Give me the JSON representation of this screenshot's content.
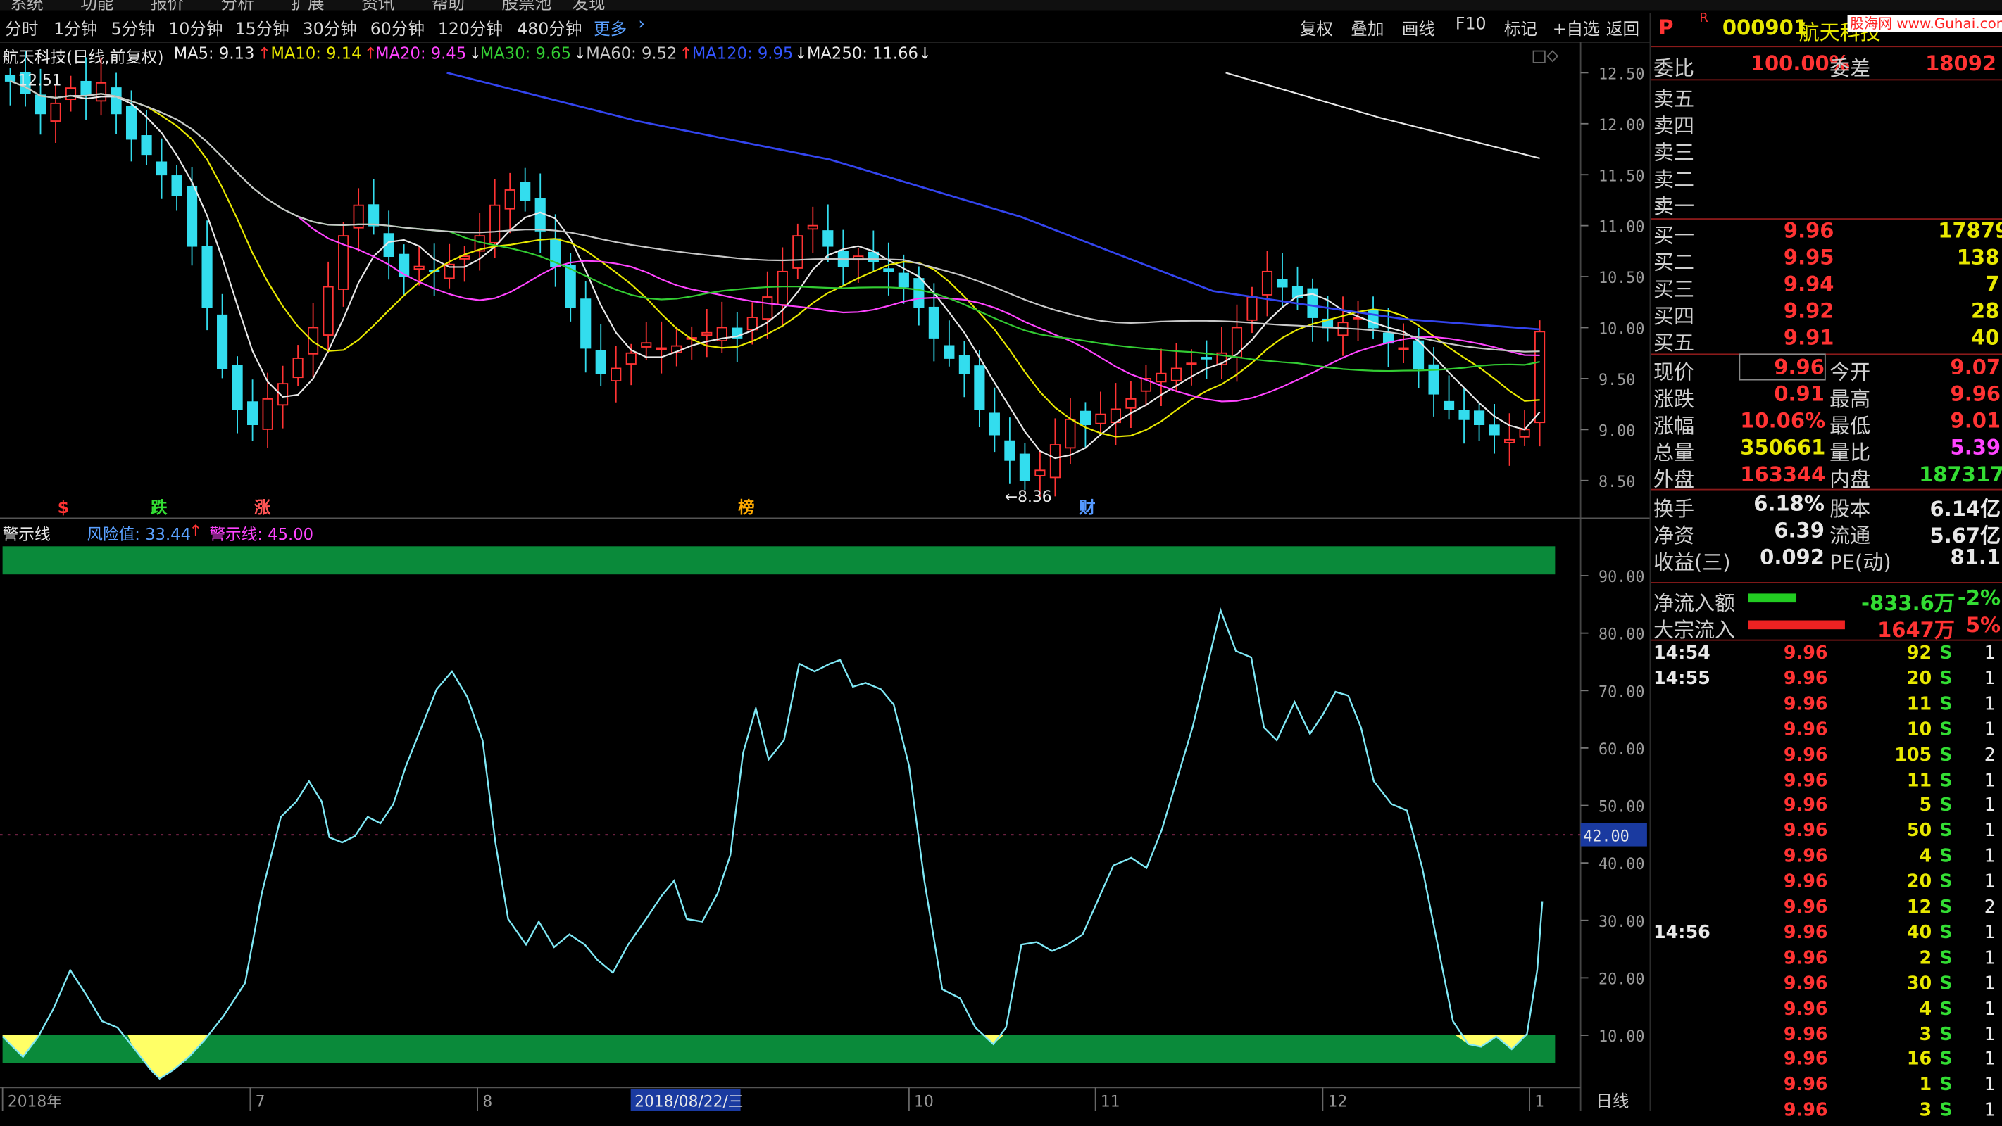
{
  "period_tabs": [
    "分时",
    "1分钟",
    "5分钟",
    "10分钟",
    "15分钟",
    "30分钟",
    "60分钟",
    "120分钟",
    "480分钟",
    "更多"
  ],
  "tools": [
    "复权",
    "叠加",
    "画线",
    "F10",
    "标记",
    "+自选",
    "返回"
  ],
  "chart_title": "航天科技(日线,前复权)",
  "ma": [
    {
      "label": "MA5: 9.13",
      "arrow": "↑",
      "color": "#e8e8e8"
    },
    {
      "label": "MA10: 9.14",
      "arrow": "↑",
      "color": "#e8e800"
    },
    {
      "label": "MA20: 9.45",
      "arrow": "↓",
      "color": "#ff44ff"
    },
    {
      "label": "MA30: 9.65",
      "arrow": "↓",
      "color": "#33cc33"
    },
    {
      "label": "MA60: 9.52",
      "arrow": "↑",
      "color": "#c8c8c8"
    },
    {
      "label": "MA120: 9.95",
      "arrow": "↓",
      "color": "#3355ff"
    },
    {
      "label": "MA250: 11.66",
      "arrow": "↓",
      "color": "#e8e8e8"
    }
  ],
  "price_axis": [
    "12.50",
    "12.00",
    "11.50",
    "11.00",
    "10.50",
    "10.00",
    "9.50",
    "9.00",
    "8.50"
  ],
  "high_label": "12.51",
  "low_label": "←8.36",
  "event_markers": [
    {
      "text": "$",
      "color": "#ff3333"
    },
    {
      "text": "跌",
      "color": "#33dd33"
    },
    {
      "text": "涨",
      "color": "#ff5555"
    },
    {
      "text": "榜",
      "color": "#ffaa00"
    },
    {
      "text": "财",
      "color": "#5599ff"
    }
  ],
  "indicator": {
    "name": "警示线",
    "risk_label": "风险值: 33.44",
    "risk_arrow": "↑",
    "warn_label": "警示线: 45.00",
    "axis": [
      "90.00",
      "80.00",
      "70.00",
      "60.00",
      "50.00",
      "40.00",
      "30.00",
      "20.00",
      "10.00"
    ],
    "ref_value": "42.00"
  },
  "date_axis": [
    "2018年",
    "7",
    "8",
    "2018/08/22/三",
    "10",
    "11",
    "12",
    "1"
  ],
  "period_label": "日线",
  "colors": {
    "up": "#ff3333",
    "down": "#33ddee",
    "ind_line": "#7fe8f5",
    "band": "#0a8a3a",
    "yellow": "#ffff66"
  },
  "quote": {
    "code": "000901",
    "name": "航天科技",
    "watermark": "股海网 www.Guhai.com.cn",
    "weibi_label": "委比",
    "weibi": "100.00%",
    "weicha_label": "委差",
    "weicha": "18092",
    "sell": [
      {
        "label": "卖五",
        "price": "",
        "vol": ""
      },
      {
        "label": "卖四",
        "price": "",
        "vol": ""
      },
      {
        "label": "卖三",
        "price": "",
        "vol": ""
      },
      {
        "label": "卖二",
        "price": "",
        "vol": ""
      },
      {
        "label": "卖一",
        "price": "",
        "vol": ""
      }
    ],
    "buy": [
      {
        "label": "买一",
        "price": "9.96",
        "vol": "17879"
      },
      {
        "label": "买二",
        "price": "9.95",
        "vol": "138"
      },
      {
        "label": "买三",
        "price": "9.94",
        "vol": "7"
      },
      {
        "label": "买四",
        "price": "9.92",
        "vol": "28"
      },
      {
        "label": "买五",
        "price": "9.91",
        "vol": "40"
      }
    ],
    "stats": [
      {
        "l1": "现价",
        "v1": "9.96",
        "c1": "red",
        "l2": "今开",
        "v2": "9.07",
        "c2": "red"
      },
      {
        "l1": "涨跌",
        "v1": "0.91",
        "c1": "red",
        "l2": "最高",
        "v2": "9.96",
        "c2": "red"
      },
      {
        "l1": "涨幅",
        "v1": "10.06%",
        "c1": "red",
        "l2": "最低",
        "v2": "9.01",
        "c2": "red"
      },
      {
        "l1": "总量",
        "v1": "350661",
        "c1": "yel",
        "l2": "量比",
        "v2": "5.39",
        "c2": "mag"
      },
      {
        "l1": "外盘",
        "v1": "163344",
        "c1": "red",
        "l2": "内盘",
        "v2": "187317",
        "c2": "grn"
      }
    ],
    "stats2": [
      {
        "l1": "换手",
        "v1": "6.18%",
        "l2": "股本",
        "v2": "6.14亿"
      },
      {
        "l1": "净资",
        "v1": "6.39",
        "l2": "流通",
        "v2": "5.67亿"
      },
      {
        "l1": "收益(三)",
        "v1": "0.092",
        "l2": "PE(动)",
        "v2": "81.1"
      }
    ],
    "flow": [
      {
        "label": "净流入额",
        "value": "-833.6万",
        "pct": "-2%",
        "color": "grn"
      },
      {
        "label": "大宗流入",
        "value": "1647万",
        "pct": "5%",
        "color": "red"
      }
    ],
    "ticks": [
      {
        "t": "14:54",
        "p": "9.96",
        "v": "92",
        "s": "S",
        "n": "1"
      },
      {
        "t": "14:55",
        "p": "9.96",
        "v": "20",
        "s": "S",
        "n": "1"
      },
      {
        "t": "",
        "p": "9.96",
        "v": "11",
        "s": "S",
        "n": "1"
      },
      {
        "t": "",
        "p": "9.96",
        "v": "10",
        "s": "S",
        "n": "1"
      },
      {
        "t": "",
        "p": "9.96",
        "v": "105",
        "s": "S",
        "n": "2"
      },
      {
        "t": "",
        "p": "9.96",
        "v": "11",
        "s": "S",
        "n": "1"
      },
      {
        "t": "",
        "p": "9.96",
        "v": "5",
        "s": "S",
        "n": "1"
      },
      {
        "t": "",
        "p": "9.96",
        "v": "50",
        "s": "S",
        "n": "1"
      },
      {
        "t": "",
        "p": "9.96",
        "v": "4",
        "s": "S",
        "n": "1"
      },
      {
        "t": "",
        "p": "9.96",
        "v": "20",
        "s": "S",
        "n": "1"
      },
      {
        "t": "",
        "p": "9.96",
        "v": "12",
        "s": "S",
        "n": "2"
      },
      {
        "t": "14:56",
        "p": "9.96",
        "v": "40",
        "s": "S",
        "n": "1"
      },
      {
        "t": "",
        "p": "9.96",
        "v": "2",
        "s": "S",
        "n": "1"
      },
      {
        "t": "",
        "p": "9.96",
        "v": "30",
        "s": "S",
        "n": "1"
      },
      {
        "t": "",
        "p": "9.96",
        "v": "4",
        "s": "S",
        "n": "1"
      },
      {
        "t": "",
        "p": "9.96",
        "v": "3",
        "s": "S",
        "n": "1"
      },
      {
        "t": "",
        "p": "9.96",
        "v": "16",
        "s": "S",
        "n": "1"
      },
      {
        "t": "",
        "p": "9.96",
        "v": "1",
        "s": "S",
        "n": "1"
      },
      {
        "t": "",
        "p": "9.96",
        "v": "3",
        "s": "S",
        "n": "1"
      }
    ]
  },
  "chart_data": {
    "type": "candlestick",
    "ylim": [
      8.3,
      12.7
    ],
    "indicator_ylim": [
      0,
      100
    ],
    "warn_line": 45.0,
    "latest_risk": 33.44,
    "closes": [
      12.42,
      12.3,
      12.1,
      12.2,
      12.35,
      12.28,
      12.4,
      12.1,
      11.85,
      11.7,
      11.5,
      11.3,
      10.8,
      10.2,
      9.6,
      9.2,
      9.05,
      9.3,
      9.45,
      9.7,
      10.0,
      10.4,
      10.9,
      11.2,
      11.0,
      10.7,
      10.5,
      10.6,
      10.55,
      10.62,
      10.7,
      10.9,
      11.2,
      11.35,
      11.25,
      10.95,
      10.6,
      10.2,
      9.8,
      9.55,
      9.6,
      9.75,
      9.85,
      9.8,
      9.82,
      9.9,
      9.95,
      10.0,
      9.9,
      10.1,
      10.3,
      10.55,
      10.9,
      11.0,
      10.8,
      10.6,
      10.7,
      10.65,
      10.55,
      10.4,
      10.2,
      9.9,
      9.7,
      9.55,
      9.2,
      8.95,
      8.7,
      8.5,
      8.6,
      8.85,
      9.1,
      9.05,
      9.15,
      9.2,
      9.3,
      9.5,
      9.55,
      9.6,
      9.65,
      9.7,
      9.75,
      10.0,
      10.3,
      10.55,
      10.4,
      10.3,
      10.1,
      10.0,
      10.05,
      10.1,
      10.0,
      9.85,
      9.8,
      9.6,
      9.35,
      9.2,
      9.1,
      9.05,
      8.95,
      8.9,
      9.0,
      9.96
    ]
  }
}
